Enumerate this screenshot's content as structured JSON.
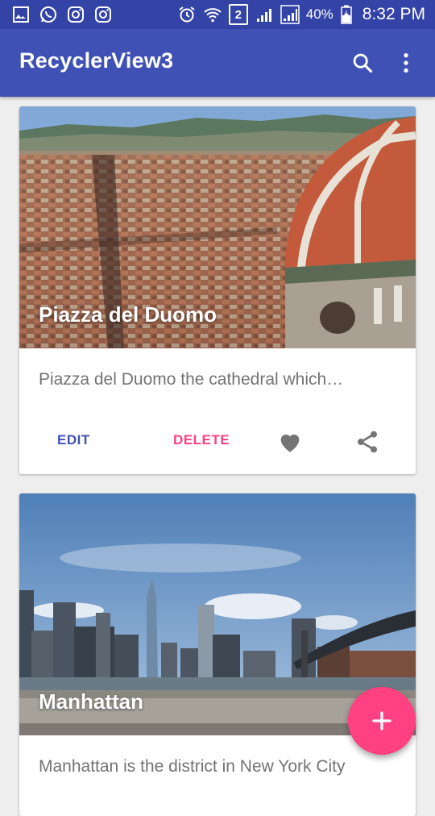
{
  "status_bar": {
    "battery_percent": "40%",
    "sim_slot": "2",
    "time": "8:32 PM"
  },
  "app_bar": {
    "title": "RecyclerView3",
    "search_icon": "search-icon",
    "overflow_icon": "more-vert-icon"
  },
  "colors": {
    "primary": "#3f51b5",
    "primary_dark": "#3443a6",
    "accent": "#ff4081"
  },
  "cards": [
    {
      "title": "Piazza del Duomo",
      "description": "Piazza del Duomo the cathedral which…",
      "edit_label": "EDIT",
      "delete_label": "DELETE",
      "favorite_icon": "heart-icon",
      "share_icon": "share-icon"
    },
    {
      "title": "Manhattan",
      "description": "Manhattan is the district in New York City"
    }
  ],
  "fab": {
    "icon": "plus-icon"
  }
}
